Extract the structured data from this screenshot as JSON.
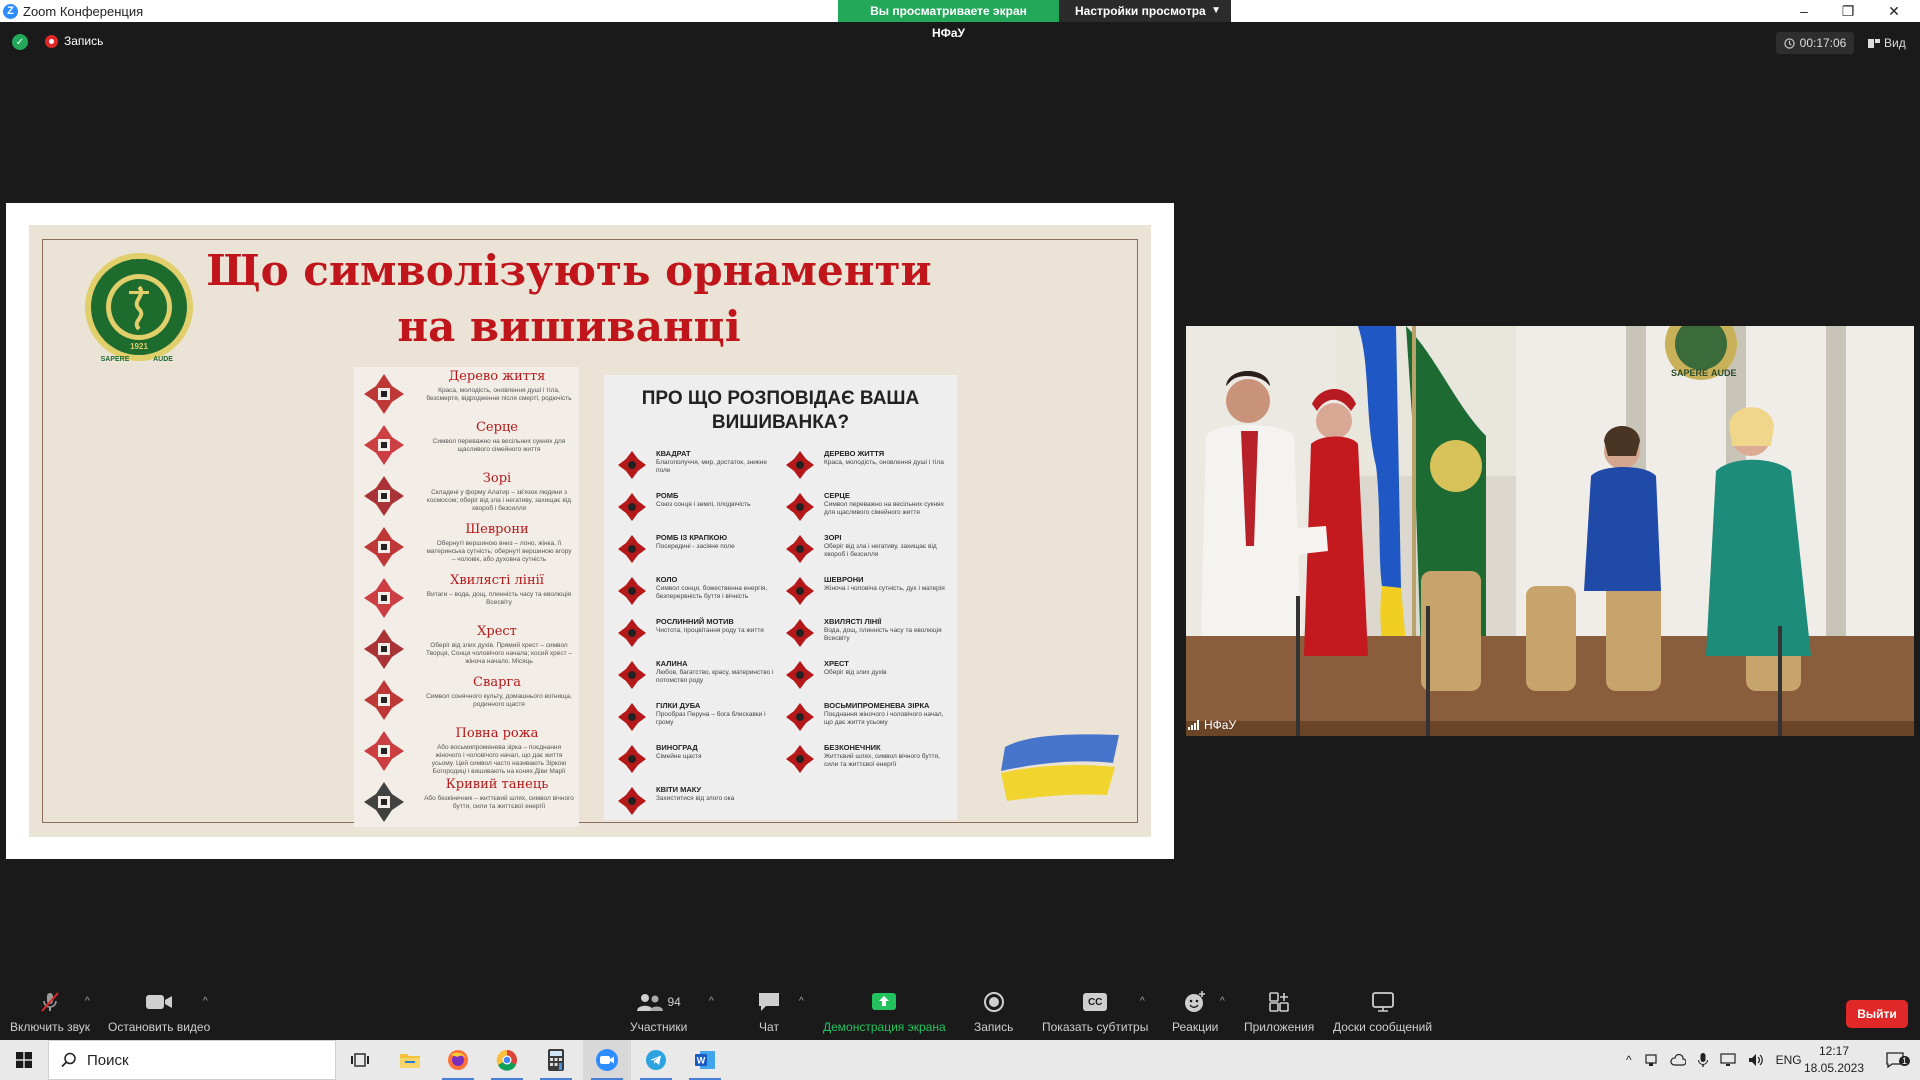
{
  "window": {
    "app_icon_letter": "Z",
    "title": "Zoom Конференция",
    "share_notice": "Вы просматриваете экран НФаУ",
    "view_settings": "Настройки просмотра",
    "minimize": "–",
    "restore": "❐",
    "close": "✕"
  },
  "topbar": {
    "recording_label": "Запись",
    "timer": "00:17:06",
    "view_label": "Вид"
  },
  "slide": {
    "title": "Що символізують орнаменти на вишиванці",
    "seal": {
      "year_top": "1805",
      "year_bottom": "1921",
      "motto_left": "SAPERE",
      "motto_right": "AUDE"
    },
    "left_items": [
      {
        "name": "Дерево життя",
        "desc": "Краса, молодість, оновлення душі і тіла, безсмертя, відродження після смерті, родючість"
      },
      {
        "name": "Серце",
        "desc": "Символ переважно на весільних сукнях для щасливого сімейного життя"
      },
      {
        "name": "Зорі",
        "desc": "Складені у форму Алатир – зв'язок людини з космосом; оберіг від зла і негативу, захищає від хвороб і безсилля"
      },
      {
        "name": "Шеврони",
        "desc": "Обернуті вершиною вниз – лоно, жінка, її материнська сутність; обернуті вершиною вгору – чоловік, або духовна сутність"
      },
      {
        "name": "Хвилясті лінії",
        "desc": "Витаги – вода, дощ, плинність часу та еволюція Всесвіту"
      },
      {
        "name": "Хрест",
        "desc": "Оберіг від злих духів. Прямий хрест – символ Творця, Сонця чоловічого начала; косий хрест – жіноча начало. Місяць"
      },
      {
        "name": "Сварга",
        "desc": "Символ сонячного культу, домашнього вогнища, родинного щастя"
      },
      {
        "name": "Повна рожа",
        "desc": "Або восьмипроменева зірка – поєднання жіночого і чоловічого начал, що дає життя усьому. Цей символ часто називають Зіркою Богородиці і вишивають на конях Діви Марії"
      },
      {
        "name": "Кривий танець",
        "desc": "Або безкінечник – життєвий шлях, символ вічного буття, сили та життєвої енергії"
      }
    ],
    "right_title": "ПРО ЩО РОЗПОВІДАЄ ВАША ВИШИВАНКА?",
    "right_items_left": [
      {
        "name": "КВАДРАТ",
        "desc": "Благополуччя, мир, достаток, зникне поле"
      },
      {
        "name": "РОМБ",
        "desc": "Союз сонця і землі, плодючість"
      },
      {
        "name": "РОМБ ІЗ КРАПКОЮ",
        "desc": "Посередині - засіяне поле"
      },
      {
        "name": "КОЛО",
        "desc": "Символ сонця, божественна енергія, безперервність буття і вічність"
      },
      {
        "name": "РОСЛИННИЙ МОТИВ",
        "desc": "Чистота, процвітання роду та життя"
      },
      {
        "name": "КАЛИНА",
        "desc": "Любов, багатство, красу, материнство і потомство роду"
      },
      {
        "name": "ГІЛКИ ДУБА",
        "desc": "Прообраз Перуна – бога блискавки і грому"
      },
      {
        "name": "ВИНОГРАД",
        "desc": "Сімейне щастя"
      },
      {
        "name": "КВІТИ МАКУ",
        "desc": "Захиститися від злого ока"
      }
    ],
    "right_items_right": [
      {
        "name": "ДЕРЕВО ЖИТТЯ",
        "desc": "Краса, молодість, оновлення душі і тіла"
      },
      {
        "name": "СЕРЦЕ",
        "desc": "Символ переважно на весільних сукнях для щасливого сімейного життя"
      },
      {
        "name": "ЗОРІ",
        "desc": "Оберіг від зла і негативу, захищає від хвороб і безсилля"
      },
      {
        "name": "ШЕВРОНИ",
        "desc": "Жіноча і чоловіча сутність, дух і матерія"
      },
      {
        "name": "ХВИЛЯСТІ ЛІНІЇ",
        "desc": "Вода, дощ, плинність часу та еволюція Всесвіту"
      },
      {
        "name": "ХРЕСТ",
        "desc": "Оберіг від злих духів"
      },
      {
        "name": "ВОСЬМИПРОМЕНЕВА ЗІРКА",
        "desc": "Поєднання жіночого і чоловічого начал, що дає життя усьому"
      },
      {
        "name": "БЕЗКОНЕЧНИК",
        "desc": "Життєвий шлях, символ вічного буття, сили та життєвої енергії"
      }
    ]
  },
  "camera": {
    "participant_label": "НФаУ",
    "seal_motto_left": "SAPERE",
    "seal_motto_right": "AUDE"
  },
  "toolbar": {
    "mute": "Включить звук",
    "video": "Остановить видео",
    "participants": "Участники",
    "participants_count": "94",
    "chat": "Чат",
    "share": "Демонстрация экрана",
    "record": "Запись",
    "captions": "Показать субтитры",
    "captions_icon_text": "CC",
    "reactions": "Реакции",
    "apps": "Приложения",
    "whiteboards": "Доски сообщений",
    "leave": "Выйти"
  },
  "taskbar": {
    "search_placeholder": "Поиск",
    "language": "ENG",
    "time": "12:17",
    "date": "18.05.2023",
    "notifications_count": "1"
  },
  "colors": {
    "zoom_blue": "#2d8cff",
    "share_green": "#23a85a",
    "leave_red": "#e02828",
    "slide_red": "#c0151b",
    "slide_bg": "#ebe4d6"
  }
}
